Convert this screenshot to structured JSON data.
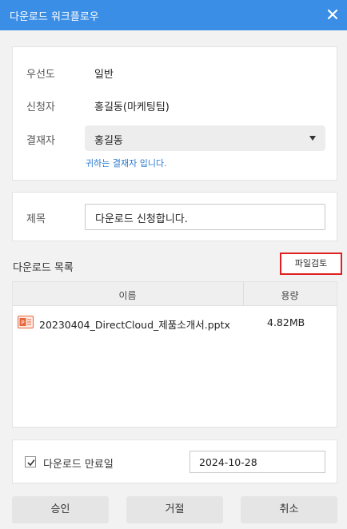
{
  "window": {
    "title": "다운로드 워크플로우",
    "close_icon": "close-icon"
  },
  "info": {
    "priority_label": "우선도",
    "priority_value": "일반",
    "requester_label": "신청자",
    "requester_value": "홍길동(마케팅팀)",
    "approver_label": "결재자",
    "approver_selected": "홍길동",
    "approver_help": "귀하는 결재자 입니다."
  },
  "subject": {
    "label": "제목",
    "value": "다운로드 신청합니다."
  },
  "download_list": {
    "title": "다운로드 목록",
    "review_button": "파일검토",
    "columns": [
      "이름",
      "용량"
    ],
    "files": [
      {
        "name": "20230404_DirectCloud_제품소개서.pptx",
        "size": "4.82MB",
        "icon": "pptx-file-icon"
      }
    ]
  },
  "expiry": {
    "checked": true,
    "label": "다운로드 만료일",
    "date": "2024-10-28"
  },
  "actions": {
    "approve": "승인",
    "reject": "거절",
    "cancel": "취소"
  },
  "colors": {
    "titlebar": "#3a8ee6",
    "link": "#2a7ad2",
    "highlight_border": "#e02020",
    "pptx_icon": "#e8663c"
  }
}
